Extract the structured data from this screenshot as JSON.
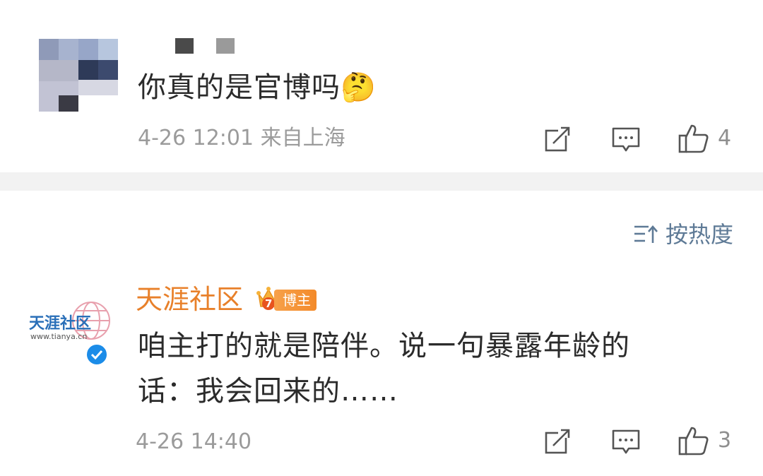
{
  "comments": [
    {
      "text": "你真的是官博吗",
      "emoji": "🤔",
      "meta": "4-26 12:01 来自上海",
      "likes": "4",
      "author_masked": true
    },
    {
      "author": "天涯社区",
      "badge": "博主",
      "badge_level": "7",
      "avatar_text": "天涯社区",
      "avatar_url_text": "www.tianya.cn",
      "text_line1": "咱主打的就是陪伴。说一句暴露年龄的",
      "text_line2": "话：我会回来的……",
      "meta": "4-26 14:40",
      "likes": "3",
      "verified": true
    }
  ],
  "sort": {
    "label": "按热度",
    "icon": "sort-icon"
  },
  "icons": {
    "share": "share-icon",
    "comment": "comment-icon",
    "like": "thumbs-up-icon"
  },
  "colors": {
    "username": "#e8802a",
    "sort_label": "#5e7a96",
    "meta_text": "#9b9b9b",
    "verified": "#1b8ce8",
    "divider": "#f2f2f2"
  }
}
